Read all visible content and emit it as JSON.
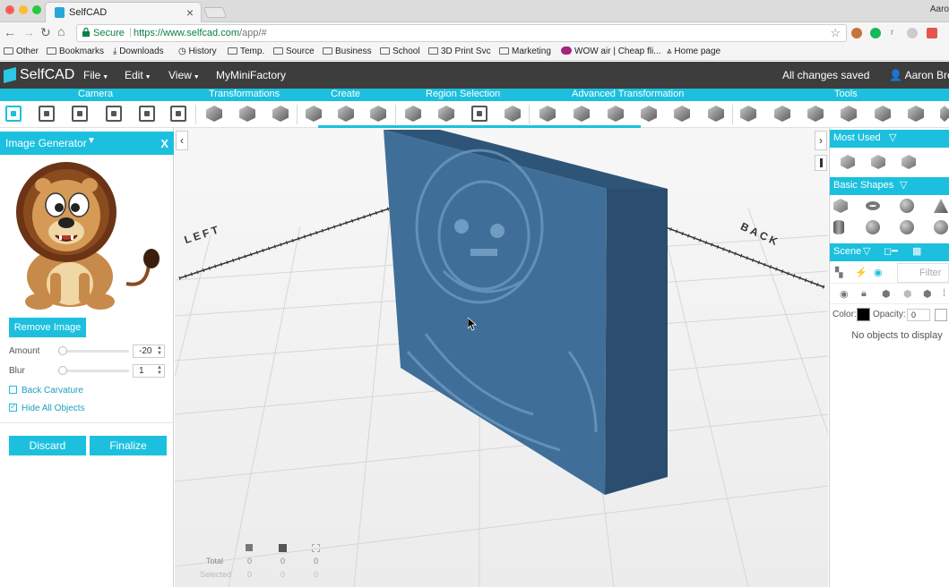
{
  "browser": {
    "tab_title": "SelfCAD",
    "tab_close": "×",
    "profile": "Aaro",
    "secure_label": "Secure",
    "url_host": "https://www.selfcad.com",
    "url_path": "/app/#",
    "bookmarks": [
      "Other",
      "Bookmarks",
      "Downloads",
      "History",
      "Temp.",
      "Source",
      "Business",
      "School",
      "3D Print Svc",
      "Marketing",
      "WOW air | Cheap fli...",
      "Home page"
    ]
  },
  "app": {
    "logo": "SelfCAD",
    "menus": [
      "File",
      "Edit",
      "View",
      "MyMiniFactory"
    ],
    "save_status": "All changes saved",
    "user": "Aaron Breu"
  },
  "toolbar": {
    "categories": [
      "Camera",
      "Transformations",
      "Create",
      "Region Selection",
      "Advanced Transformation",
      "Tools"
    ]
  },
  "image_generator": {
    "title": "Image Generator",
    "close": "X",
    "remove_label": "Remove Image",
    "amount_label": "Amount",
    "amount_value": "-20",
    "blur_label": "Blur",
    "blur_value": "1",
    "back_curvature_label": "Back Carvature",
    "back_curvature_checked": false,
    "hide_all_label": "Hide All Objects",
    "hide_all_checked": true,
    "discard_label": "Discard",
    "finalize_label": "Finalize"
  },
  "viewport": {
    "label_left": "LEFT",
    "label_back": "BACK",
    "stats": {
      "total_label": "Total",
      "selected_label": "Selected",
      "total_values": [
        "0",
        "0",
        "0"
      ],
      "selected_values": [
        "0",
        "0",
        "0"
      ]
    }
  },
  "right_panel": {
    "most_used": "Most Used",
    "basic_shapes": "Basic Shapes",
    "scene": "Scene",
    "filter_placeholder": "Filter",
    "color_label": "Color:",
    "color_value": "#000000",
    "opacity_label": "Opacity:",
    "opacity_value": "0",
    "empty_text": "No objects to display"
  },
  "colors": {
    "accent": "#1cc0de",
    "header": "#3d3d3d",
    "model": "#3f6f99"
  }
}
